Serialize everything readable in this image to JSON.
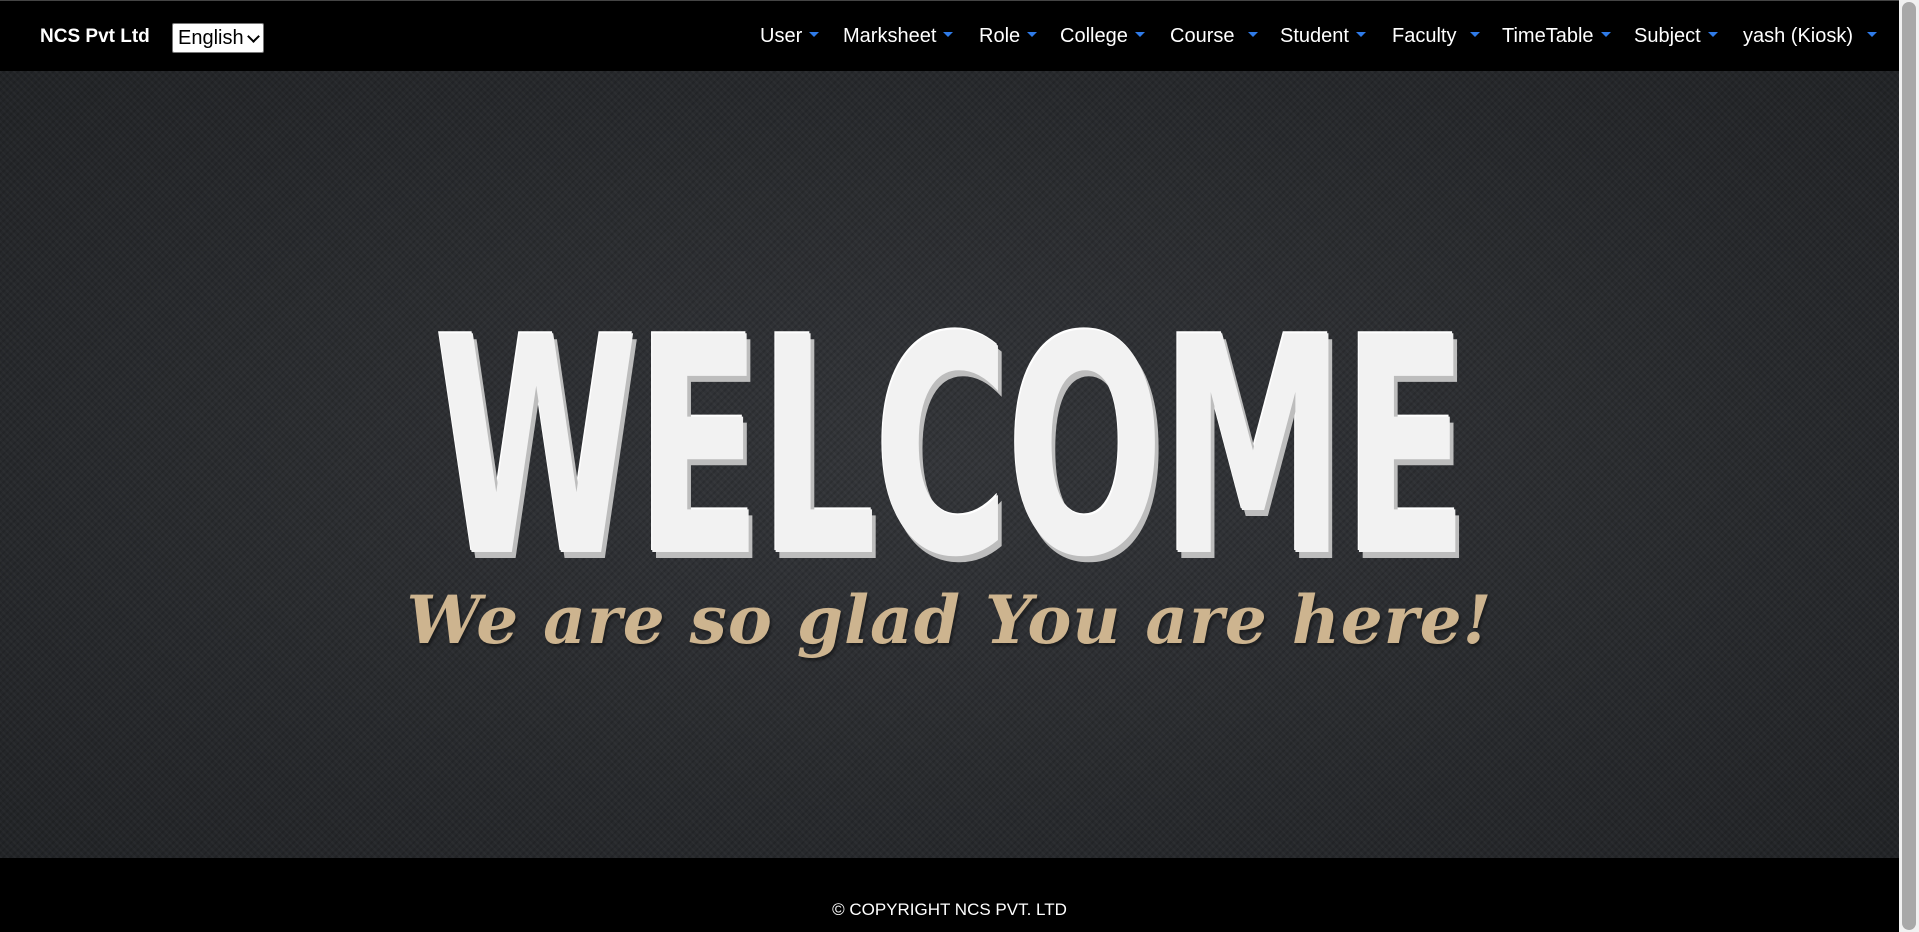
{
  "brand": "NCS Pvt Ltd",
  "language_select": {
    "value": "English"
  },
  "nav": [
    {
      "label": "User"
    },
    {
      "label": "Marksheet"
    },
    {
      "label": "Role"
    },
    {
      "label": "College"
    },
    {
      "label": "Course"
    },
    {
      "label": "Student"
    },
    {
      "label": "Faculty"
    },
    {
      "label": "TimeTable"
    },
    {
      "label": "Subject"
    },
    {
      "label": "yash (Kiosk)"
    }
  ],
  "hero": {
    "heading": "WELCOME",
    "tagline": "We are so glad You are here!"
  },
  "footer": {
    "copyright": "© COPYRIGHT NCS PVT. LTD"
  },
  "colors": {
    "caret": "#2f7be8",
    "tagline": "#cdb48f",
    "hero_bg": "#2a2c2f"
  }
}
